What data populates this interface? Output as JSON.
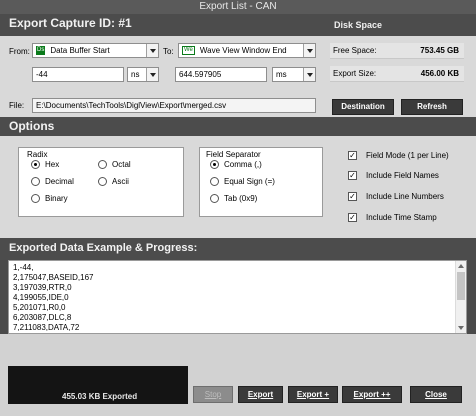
{
  "window": {
    "title": "Export List - CAN"
  },
  "header": {
    "capture_title": "Export Capture ID: #1",
    "disk_title": "Disk Space"
  },
  "from": {
    "label": "From:",
    "tag": "Ds",
    "value": "Data Buffer Start",
    "offset_value": "-44",
    "unit": "ns"
  },
  "to": {
    "label": "To:",
    "tag": "We",
    "value": "Wave View Window End",
    "offset_value": "644.597905",
    "unit": "ms"
  },
  "disk": {
    "free_label": "Free Space:",
    "free_value": "753.45 GB",
    "export_label": "Export Size:",
    "export_value": "456.00 KB"
  },
  "file": {
    "label": "File:",
    "path": "E:\\Documents\\TechTools\\DiglView\\Export\\merged.csv",
    "destination_label": "Destination",
    "refresh_label": "Refresh"
  },
  "options": {
    "title": "Options",
    "radix": {
      "title": "Radix",
      "items": [
        {
          "label": "Hex",
          "selected": true
        },
        {
          "label": "Octal",
          "selected": false
        },
        {
          "label": "Decimal",
          "selected": false
        },
        {
          "label": "Ascii",
          "selected": false
        },
        {
          "label": "Binary",
          "selected": false
        }
      ]
    },
    "separator": {
      "title": "Field Separator",
      "items": [
        {
          "label": "Comma (,)",
          "selected": true
        },
        {
          "label": "Equal Sign (=)",
          "selected": false
        },
        {
          "label": "Tab (0x9)",
          "selected": false
        }
      ]
    },
    "checks": [
      {
        "label": "Field Mode (1 per Line)",
        "checked": true
      },
      {
        "label": "Include Field Names",
        "checked": true
      },
      {
        "label": "Include Line Numbers",
        "checked": true
      },
      {
        "label": "Include Time Stamp",
        "checked": true
      }
    ]
  },
  "example": {
    "title": "Exported Data Example & Progress:",
    "lines": [
      "1,-44,",
      "2,175047,BASEID,167",
      "3,197039,RTR,0",
      "4,199055,IDE,0",
      "5,201071,R0,0",
      "6,203087,DLC,8",
      "7,211083,DATA,72"
    ]
  },
  "progress": {
    "text": "455.03 KB Exported"
  },
  "buttons": {
    "stop": "Stop",
    "export": "Export",
    "export_plus": "Export +",
    "export_plusplus": "Export ++",
    "close": "Close"
  }
}
